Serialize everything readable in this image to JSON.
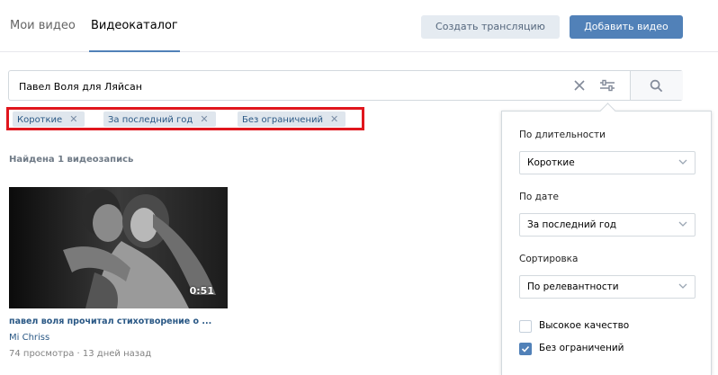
{
  "tabs": [
    {
      "label": "Мои видео",
      "active": false
    },
    {
      "label": "Видеокаталог",
      "active": true
    }
  ],
  "header": {
    "create_stream_label": "Создать трансляцию",
    "add_video_label": "Добавить видео"
  },
  "search": {
    "value": "Павел Воля для Ляйсан"
  },
  "chips": [
    "Короткие",
    "За последний год",
    "Без ограничений"
  ],
  "results": {
    "found_text": "Найдена 1 видеозапись"
  },
  "video": {
    "duration": "0:51",
    "title": "павел воля прочитал стихотворение о ...",
    "author": "Mi Chriss",
    "meta": "74 просмотра · 13 дней назад"
  },
  "filters": {
    "duration_label": "По длительности",
    "duration_value": "Короткие",
    "date_label": "По дате",
    "date_value": "За последний год",
    "sort_label": "Сортировка",
    "sort_value": "По релевантности",
    "hq_label": "Высокое качество",
    "hq_checked": false,
    "unsafe_label": "Без ограничений",
    "unsafe_checked": true
  },
  "colors": {
    "accent": "#5181b8",
    "link": "#2a5885",
    "highlight_frame": "#e0161d"
  }
}
